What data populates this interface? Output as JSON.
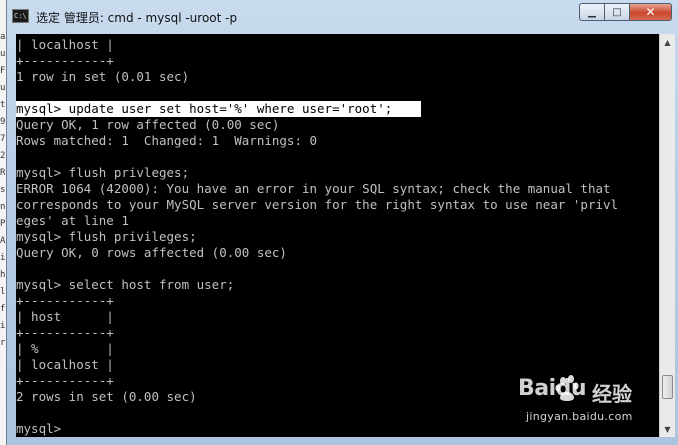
{
  "window": {
    "title": "选定 管理员: cmd - mysql  -uroot -p",
    "icon_text": "C:\\",
    "controls": {
      "minimize": "minimize-icon",
      "maximize": "maximize-icon",
      "close": "close-icon"
    }
  },
  "console": {
    "lines": [
      "| localhost |",
      "+-----------+",
      "1 row in set (0.01 sec)",
      "",
      "mysql> update user set host='%' where user='root';",
      "Query OK, 1 row affected (0.00 sec)",
      "Rows matched: 1  Changed: 1  Warnings: 0",
      "",
      "mysql> flush privleges;",
      "ERROR 1064 (42000): You have an error in your SQL syntax; check the manual that",
      "corresponds to your MySQL server version for the right syntax to use near 'privl",
      "eges' at line 1",
      "mysql> flush privileges;",
      "Query OK, 0 rows affected (0.00 sec)",
      "",
      "mysql> select host from user;",
      "+-----------+",
      "| host      |",
      "+-----------+",
      "| %         |",
      "| localhost |",
      "+-----------+",
      "2 rows in set (0.00 sec)",
      "",
      "mysql>"
    ],
    "selected_line_index": 4
  },
  "background_window_chars": [
    "a",
    "u",
    "F",
    "u",
    "t",
    "9",
    "7",
    "2",
    "R",
    "s",
    "n",
    "P",
    "A",
    "i",
    "h",
    "l",
    "f",
    "i",
    "r"
  ],
  "watermark": {
    "brand": "Baidu",
    "cn_text": "经验",
    "url": "jingyan.baidu.com"
  },
  "colors": {
    "console_bg": "#000000",
    "console_text": "#c0c0c0",
    "selection_bg": "#ffffff",
    "close_button": "#c9472c",
    "titlebar": "#c9dbee"
  }
}
